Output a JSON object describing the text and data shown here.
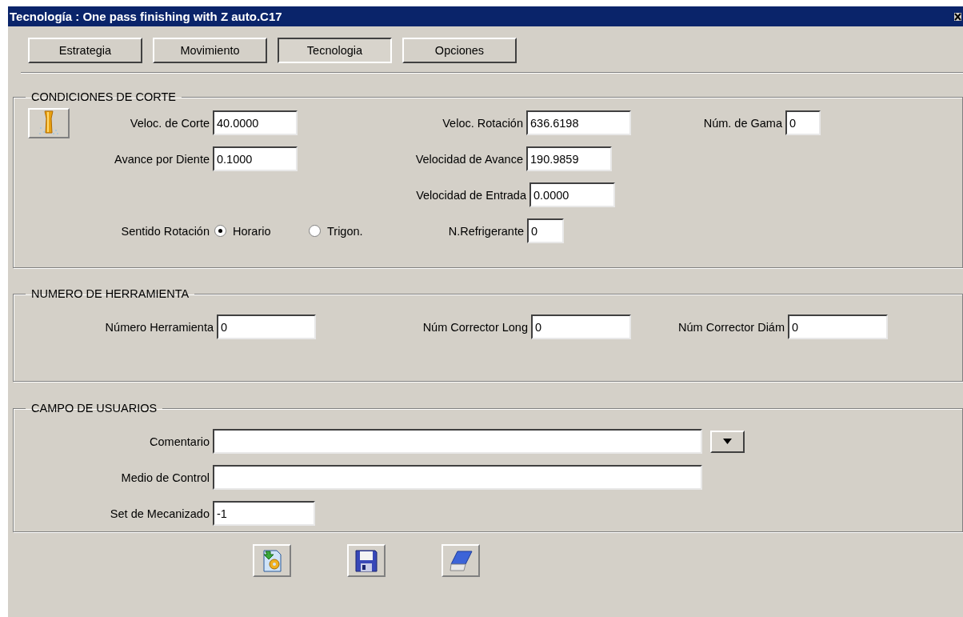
{
  "window": {
    "title": "Tecnología : One pass finishing with Z auto.C17"
  },
  "tabs": [
    {
      "label": "Estrategia",
      "selected": false
    },
    {
      "label": "Movimiento",
      "selected": false
    },
    {
      "label": "Tecnologia",
      "selected": true
    },
    {
      "label": "Opciones",
      "selected": false
    }
  ],
  "cutting_conditions": {
    "title": "CONDICIONES DE CORTE",
    "fields": [
      {
        "label": "Veloc. de Corte",
        "value": "40.0000"
      },
      {
        "label": "Veloc. Rotación",
        "value": "636.6198"
      },
      {
        "label": "Núm. de Gama",
        "value": "0"
      },
      {
        "label": "Avance por Diente",
        "value": "0.1000"
      },
      {
        "label": "Velocidad de Avance",
        "value": "190.9859"
      },
      {
        "label": "Velocidad de Entrada",
        "value": "0.0000"
      },
      {
        "label": "N.Refrigerante",
        "value": "0"
      }
    ],
    "rotation": {
      "label": "Sentido Rotación",
      "options": [
        {
          "label": "Horario",
          "selected": true
        },
        {
          "label": "Trigon.",
          "selected": false
        }
      ]
    }
  },
  "tool_number": {
    "title": "NUMERO DE HERRAMIENTA",
    "fields": [
      {
        "label": "Número Herramienta",
        "value": "0"
      },
      {
        "label": "Núm Corrector Long",
        "value": "0"
      },
      {
        "label": "Núm Corrector Diám",
        "value": "0"
      }
    ]
  },
  "user_fields": {
    "title": "CAMPO DE USUARIOS",
    "fields": [
      {
        "label": "Comentario"
      },
      {
        "label": "Medio de Control"
      },
      {
        "label": "Set de Mecanizado",
        "value": "-1"
      }
    ]
  }
}
